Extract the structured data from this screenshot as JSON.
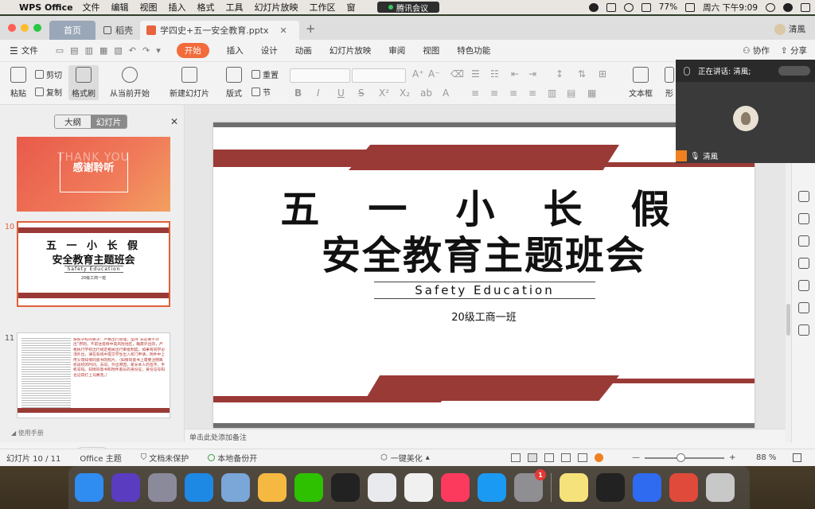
{
  "menubar": {
    "app_name": "WPS Office",
    "items": [
      "文件",
      "编辑",
      "视图",
      "插入",
      "格式",
      "工具",
      "幻灯片放映",
      "工作区",
      "窗"
    ],
    "meeting_pill": "腾讯会议",
    "battery": "77%",
    "datetime": "周六 下午9:09"
  },
  "tabs": {
    "home": "首页",
    "docer": "稻壳",
    "document": "学四史+五一安全教育.pptx",
    "user": "清風"
  },
  "menu_row": {
    "file": "文件",
    "active": "开始",
    "items": [
      "插入",
      "设计",
      "动画",
      "幻灯片放映",
      "审阅",
      "视图",
      "特色功能"
    ],
    "collab": "协作",
    "share": "分享"
  },
  "ribbon": {
    "paste": "粘贴",
    "cut": "剪切",
    "copy": "复制",
    "format_painter": "格式刷",
    "play_from_current": "从当前开始",
    "new_slide": "新建幻灯片",
    "layout": "版式",
    "reset": "重置",
    "section": "节",
    "textbox": "文本框",
    "shape": "形"
  },
  "left_pane": {
    "tab_outline": "大纲",
    "tab_slides": "幻灯片",
    "usage": "使用手册",
    "thumbs": [
      {
        "num": "",
        "line1": "THANK YOU",
        "line2": "感谢聆听"
      },
      {
        "num": "10",
        "line1": "五 一 小 长 假",
        "line2": "安全教育主题班会",
        "line3": "Safety Education",
        "line4": "20级工商一班"
      },
      {
        "num": "11",
        "text": "按照学校的要求：严格出行管理，坚持“非必要不外出”原则，不前往疫情中高风险地区，确需外出的，严格执行学校出行规定相关出行审批制度。如果有同学必须外出，请在系统中提交学生出入校门申请，附件中上传父母知情同意书的照片，（知情同意书上需要注明离校返校的时间，去向，外出原因，家长本人的签字，手机号码。知情同意书和附件家长的身份证，身份证号码也记得打上马赛克。）"
      }
    ]
  },
  "slide": {
    "title_line1": "五 一 小 长 假",
    "title_line2": "安全教育主题班会",
    "subtitle": "Safety Education",
    "class_name": "20级工商一班"
  },
  "notes_placeholder": "单击此处添加备注",
  "status": {
    "slide_counter": "幻灯片 10 / 11",
    "theme": "Office 主题",
    "protect": "文档未保护",
    "backup": "本地备份开",
    "beautify": "一键美化",
    "zoom": "88 %"
  },
  "meeting": {
    "speaking": "正在讲话: 清風;",
    "participant": "清風"
  },
  "dock": {
    "apps": [
      {
        "name": "finder-icon",
        "color": "#2f8cf0"
      },
      {
        "name": "siri-icon",
        "color": "#5a3cc0"
      },
      {
        "name": "launchpad-icon",
        "color": "#8a8a9a"
      },
      {
        "name": "safari-icon",
        "color": "#1e88e5"
      },
      {
        "name": "preview-icon",
        "color": "#7aa6d8"
      },
      {
        "name": "photos-icon",
        "color": "#f5b942"
      },
      {
        "name": "wechat-icon",
        "color": "#2dc100"
      },
      {
        "name": "qq-icon",
        "color": "#222222"
      },
      {
        "name": "chrome-icon",
        "color": "#e8eaed"
      },
      {
        "name": "wps-icon",
        "color": "#f0f0f0"
      },
      {
        "name": "music-icon",
        "color": "#fb3a5e"
      },
      {
        "name": "app-store-icon",
        "color": "#1a9af2"
      },
      {
        "name": "system-preferences-icon",
        "color": "#8e8e93",
        "badge": "1"
      },
      {
        "name": "notes-icon",
        "color": "#f6e27a"
      },
      {
        "name": "qq-icon-2",
        "color": "#222222"
      },
      {
        "name": "lark-icon",
        "color": "#2f6bf0"
      },
      {
        "name": "pdf-icon",
        "color": "#e04a3a"
      },
      {
        "name": "trash-icon",
        "color": "#c8c8c8"
      }
    ]
  },
  "colors": {
    "accent": "#f26b3a",
    "slide_red": "#9a3a36",
    "slide_dark": "#6e6e6e"
  }
}
